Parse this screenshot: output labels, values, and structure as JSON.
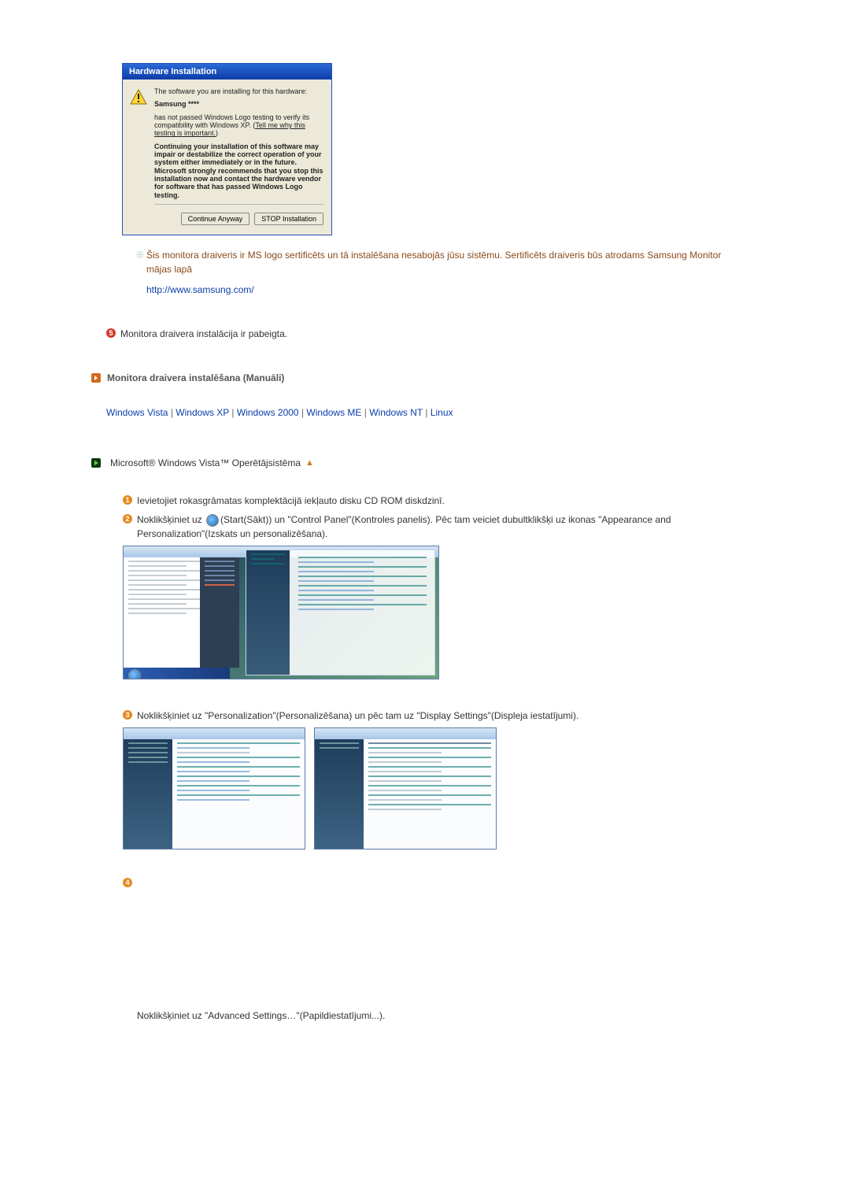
{
  "dialog": {
    "title": "Hardware Installation",
    "line1": "The software you are installing for this hardware:",
    "device": "Samsung ****",
    "line2a": "has not passed Windows Logo testing to verify its compatibility with Windows XP. (",
    "tell_link": "Tell me why this testing is important.",
    "line2b": ")",
    "warn": "Continuing your installation of this software may impair or destabilize the correct operation of your system either immediately or in the future. Microsoft strongly recommends that you stop this installation now and contact the hardware vendor for software that has passed Windows Logo testing.",
    "btn_continue": "Continue Anyway",
    "btn_stop": "STOP Installation"
  },
  "note": {
    "text": "Šis monitora draiveris ir MS logo sertificēts un tā instalēšana nesabojās jūsu sistēmu. Sertificēts draiveris būs atrodams Samsung Monitor mājas lapā",
    "url": "http://www.samsung.com/"
  },
  "step5": {
    "num": "5",
    "text": "Monitora draivera instalācija ir pabeigta."
  },
  "section_manual": "Monitora draivera instalēšana (Manuāli)",
  "os_links": {
    "vista": "Windows Vista",
    "xp": "Windows XP",
    "w2000": "Windows 2000",
    "wme": "Windows ME",
    "wnt": "Windows NT",
    "linux": "Linux",
    "sep": " | "
  },
  "os_heading": "Microsoft® Windows Vista™ Operētājsistēma",
  "vista_steps": {
    "s1_num": "1",
    "s1_text": "Ievietojiet rokasgrāmatas komplektācijā iekļauto disku CD ROM diskdzinī.",
    "s2_num": "2",
    "s2_text_a": "Noklikšķiniet uz ",
    "s2_text_b": "(Start(Sākt)) un \"Control Panel\"(Kontroles panelis). Pēc tam veiciet dubultklikšķi uz ikonas \"Appearance and Personalization\"(Izskats un personalizēšana).",
    "s3_num": "3",
    "s3_text": "Noklikšķiniet uz \"Personalization\"(Personalizēšana) un pēc tam uz \"Display Settings\"(Displeja iestatījumi).",
    "s4_num": "4",
    "s4_text": "Noklikšķiniet uz \"Advanced Settings…\"(Papildiestatījumi...)."
  }
}
